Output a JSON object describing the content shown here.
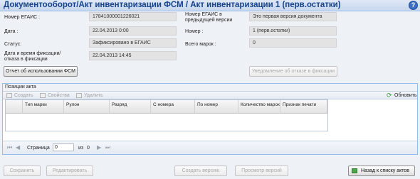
{
  "header": {
    "title": "Документооборот/Акт инвентаризации ФСМ / Акт инвентаризации  1 (перв.остатки)",
    "help_icon": "?"
  },
  "form": {
    "egais_number_label": "Номер ЕГАИС :",
    "egais_number_value": "17841000001226021",
    "prev_egais_label_1": "Номер ЕГАИС в",
    "prev_egais_label_2": "предыдущей версии",
    "prev_egais_value": "Это первая версия документа",
    "date_label": "Дата :",
    "date_value": "22.04.2013 0:00",
    "number_label": "Номер :",
    "number_value": "1 (перв.остатки)",
    "status_label": "Статус:",
    "status_value": "Зафиксировано в ЕГАИС",
    "total_marks_label": "Всего марок :",
    "total_marks_value": "0",
    "fix_date_label_1": "Дата и время фиксации/",
    "fix_date_label_2": "отказа в фиксации",
    "fix_date_value": "22.04.2013 14:45",
    "report_button": "Отчет об использовании ФСМ",
    "refusal_button": "Уведомление об отказе в фиксации"
  },
  "positions": {
    "title": "Позиции акта",
    "toolbar": {
      "create": "Создать",
      "properties": "Свойства",
      "delete": "Удалить",
      "refresh": "Обновить"
    },
    "columns": [
      "Тип марки",
      "Рулон",
      "Разряд",
      "С номера",
      "По номер",
      "Количество марок",
      "Признак печати"
    ],
    "pager": {
      "page_label": "Страница",
      "page_value": "0",
      "of_label": "из",
      "total_pages": "0"
    }
  },
  "footer": {
    "save": "Сохранить",
    "edit": "Редактировать",
    "create_version": "Создать версию",
    "view_versions": "Просмотр версий",
    "back": "Назад к списку актов"
  }
}
